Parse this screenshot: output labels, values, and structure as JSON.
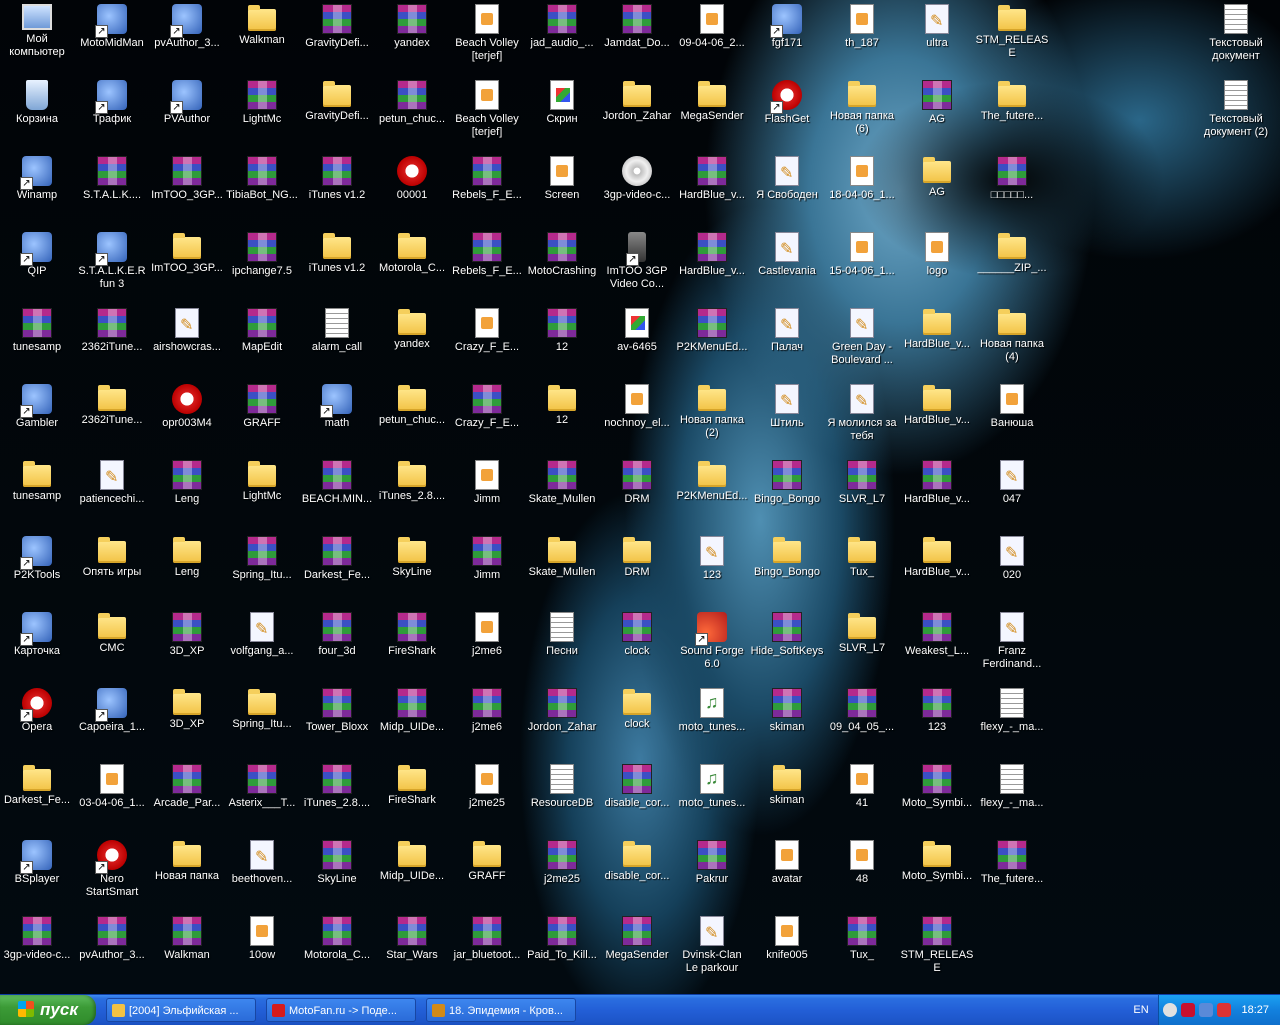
{
  "desktop": {
    "columns": [
      [
        {
          "label": "Мой компьютер",
          "icon": "my-computer-icon"
        },
        {
          "label": "Корзина",
          "icon": "recycle-bin-icon"
        },
        {
          "label": "Winamp",
          "icon": "winamp-icon"
        },
        {
          "label": "QIP",
          "icon": "qip-icon"
        },
        {
          "label": "tunesamp",
          "icon": "rar-archive-icon"
        },
        {
          "label": "Gambler",
          "icon": "gambler-icon"
        },
        {
          "label": "tunesamp",
          "icon": "folder-icon"
        },
        {
          "label": "P2KTools",
          "icon": "p2ktools-icon"
        },
        {
          "label": "Карточка",
          "icon": "shortcut-icon"
        },
        {
          "label": "Opera",
          "icon": "opera-icon"
        },
        {
          "label": "Darkest_Fe...",
          "icon": "folder-icon"
        },
        {
          "label": "BSplayer",
          "icon": "bsplayer-icon"
        },
        {
          "label": "3gp-video-c...",
          "icon": "rar-archive-icon"
        }
      ],
      [
        {
          "label": "MotoMidMan",
          "icon": "motomidman-icon"
        },
        {
          "label": "Трафик",
          "icon": "traffic-icon"
        },
        {
          "label": "S.T.A.L.K....",
          "icon": "rar-archive-icon"
        },
        {
          "label": "S.T.A.L.K.E.R fun 3",
          "icon": "3gp-icon"
        },
        {
          "label": "2362iTune...",
          "icon": "rar-archive-icon"
        },
        {
          "label": "2362iTune...",
          "icon": "folder-icon"
        },
        {
          "label": "patiencechi...",
          "icon": "jar-file-icon"
        },
        {
          "label": "Опять игры",
          "icon": "folder-icon"
        },
        {
          "label": "CMC",
          "icon": "folder-icon"
        },
        {
          "label": "Capoeira_1...",
          "icon": "3gp-icon"
        },
        {
          "label": "03-04-06_1...",
          "icon": "image-file-icon"
        },
        {
          "label": "Nero StartSmart",
          "icon": "nero-icon"
        },
        {
          "label": "pvAuthor_3...",
          "icon": "rar-archive-icon"
        }
      ],
      [
        {
          "label": "pvAuthor_3...",
          "icon": "installer-icon"
        },
        {
          "label": "PVAuthor",
          "icon": "pvauthor-icon"
        },
        {
          "label": "ImTOO_3GP...",
          "icon": "rar-archive-icon"
        },
        {
          "label": "ImTOO_3GP...",
          "icon": "folder-icon"
        },
        {
          "label": "airshowcras...",
          "icon": "jar-file-icon"
        },
        {
          "label": "opr003M4",
          "icon": "opera-file-icon"
        },
        {
          "label": "Leng",
          "icon": "rar-archive-icon"
        },
        {
          "label": "Leng",
          "icon": "folder-icon"
        },
        {
          "label": "3D_XP",
          "icon": "rar-archive-icon"
        },
        {
          "label": "3D_XP",
          "icon": "folder-icon"
        },
        {
          "label": "Arcade_Par...",
          "icon": "rar-archive-icon"
        },
        {
          "label": "Новая папка",
          "icon": "folder-icon"
        },
        {
          "label": "Walkman",
          "icon": "rar-archive-icon"
        }
      ],
      [
        {
          "label": "Walkman",
          "icon": "folder-icon"
        },
        {
          "label": "LightMc",
          "icon": "rar-archive-icon"
        },
        {
          "label": "TibiaBot_NG...",
          "icon": "rar-archive-icon"
        },
        {
          "label": "ipchange7.5",
          "icon": "rar-archive-icon"
        },
        {
          "label": "MapEdit",
          "icon": "rar-archive-icon"
        },
        {
          "label": "GRAFF",
          "icon": "rar-archive-icon"
        },
        {
          "label": "LightMc",
          "icon": "folder-icon"
        },
        {
          "label": "Spring_Itu...",
          "icon": "rar-archive-icon"
        },
        {
          "label": "volfgang_a...",
          "icon": "jar-file-icon"
        },
        {
          "label": "Spring_Itu...",
          "icon": "folder-icon"
        },
        {
          "label": "Asterix___T...",
          "icon": "rar-archive-icon"
        },
        {
          "label": "beethoven...",
          "icon": "jar-file-icon"
        },
        {
          "label": "10ow",
          "icon": "image-file-icon"
        }
      ],
      [
        {
          "label": "GravityDefi...",
          "icon": "rar-archive-icon"
        },
        {
          "label": "GravityDefi...",
          "icon": "folder-icon"
        },
        {
          "label": "iTunes v1.2",
          "icon": "rar-archive-icon"
        },
        {
          "label": "iTunes v1.2",
          "icon": "folder-icon"
        },
        {
          "label": "alarm_call",
          "icon": "text-file-icon"
        },
        {
          "label": "math",
          "icon": "math-icon"
        },
        {
          "label": "BEACH.MIN...",
          "icon": "rar-archive-icon"
        },
        {
          "label": "Darkest_Fe...",
          "icon": "rar-archive-icon"
        },
        {
          "label": "four_3d",
          "icon": "rar-archive-icon"
        },
        {
          "label": "Tower_Bloxx",
          "icon": "rar-archive-icon"
        },
        {
          "label": "iTunes_2.8....",
          "icon": "rar-archive-icon"
        },
        {
          "label": "SkyLine",
          "icon": "rar-archive-icon"
        },
        {
          "label": "Motorola_C...",
          "icon": "rar-archive-icon"
        }
      ],
      [
        {
          "label": "yandex",
          "icon": "rar-archive-icon"
        },
        {
          "label": "petun_chuc...",
          "icon": "rar-archive-icon"
        },
        {
          "label": "00001",
          "icon": "opera-file-icon"
        },
        {
          "label": "Motorola_C...",
          "icon": "folder-icon"
        },
        {
          "label": "yandex",
          "icon": "folder-icon"
        },
        {
          "label": "petun_chuc...",
          "icon": "folder-icon"
        },
        {
          "label": "iTunes_2.8....",
          "icon": "folder-icon"
        },
        {
          "label": "SkyLine",
          "icon": "folder-icon"
        },
        {
          "label": "FireShark",
          "icon": "rar-archive-icon"
        },
        {
          "label": "Midp_UIDe...",
          "icon": "rar-archive-icon"
        },
        {
          "label": "FireShark",
          "icon": "folder-icon"
        },
        {
          "label": "Midp_UIDe...",
          "icon": "folder-icon"
        },
        {
          "label": "Star_Wars",
          "icon": "rar-archive-icon"
        }
      ],
      [
        {
          "label": "Beach Volley [terjef]",
          "icon": "jad-file-icon"
        },
        {
          "label": "Beach Volley [terjef]",
          "icon": "jad-file-icon"
        },
        {
          "label": "Rebels_F_E...",
          "icon": "rar-archive-icon"
        },
        {
          "label": "Rebels_F_E...",
          "icon": "rar-archive-icon"
        },
        {
          "label": "Crazy_F_E...",
          "icon": "jad-file-icon"
        },
        {
          "label": "Crazy_F_E...",
          "icon": "rar-archive-icon"
        },
        {
          "label": "Jimm",
          "icon": "jad-file-icon"
        },
        {
          "label": "Jimm",
          "icon": "rar-archive-icon"
        },
        {
          "label": "j2me6",
          "icon": "jad-file-icon"
        },
        {
          "label": "j2me6",
          "icon": "rar-archive-icon"
        },
        {
          "label": "j2me25",
          "icon": "jad-file-icon"
        },
        {
          "label": "GRAFF",
          "icon": "folder-icon"
        },
        {
          "label": "jar_bluetoot...",
          "icon": "rar-archive-icon"
        }
      ],
      [
        {
          "label": "jad_audio_...",
          "icon": "rar-archive-icon"
        },
        {
          "label": "Скрин",
          "icon": "paint-icon"
        },
        {
          "label": "Screen",
          "icon": "image-file-icon"
        },
        {
          "label": "MotoCrashing",
          "icon": "rar-archive-icon"
        },
        {
          "label": "12",
          "icon": "rar-archive-icon"
        },
        {
          "label": "12",
          "icon": "folder-icon"
        },
        {
          "label": "Skate_Mullen",
          "icon": "rar-archive-icon"
        },
        {
          "label": "Skate_Mullen",
          "icon": "folder-icon"
        },
        {
          "label": "Песни",
          "icon": "text-file-icon"
        },
        {
          "label": "Jordon_Zahar",
          "icon": "rar-archive-icon"
        },
        {
          "label": "ResourceDB",
          "icon": "resource-file-icon"
        },
        {
          "label": "j2me25",
          "icon": "rar-archive-icon"
        },
        {
          "label": "Paid_To_Kill...",
          "icon": "rar-archive-icon"
        }
      ],
      [
        {
          "label": "Jamdat_Do...",
          "icon": "rar-archive-icon"
        },
        {
          "label": "Jordon_Zahar",
          "icon": "folder-icon"
        },
        {
          "label": "3gp-video-c...",
          "icon": "disc-icon"
        },
        {
          "label": "ImTOO 3GP Video Co...",
          "icon": "phone-icon"
        },
        {
          "label": "av-6465",
          "icon": "png-file-icon"
        },
        {
          "label": "nochnoy_el...",
          "icon": "image-file-icon"
        },
        {
          "label": "DRM",
          "icon": "rar-archive-icon"
        },
        {
          "label": "DRM",
          "icon": "folder-icon"
        },
        {
          "label": "clock",
          "icon": "rar-archive-icon"
        },
        {
          "label": "clock",
          "icon": "folder-icon"
        },
        {
          "label": "disable_cor...",
          "icon": "rar-archive-icon"
        },
        {
          "label": "disable_cor...",
          "icon": "folder-icon"
        },
        {
          "label": "MegaSender",
          "icon": "rar-archive-icon"
        }
      ],
      [
        {
          "label": "09-04-06_2...",
          "icon": "image-file-icon"
        },
        {
          "label": "MegaSender",
          "icon": "folder-icon"
        },
        {
          "label": "HardBlue_v...",
          "icon": "rar-archive-icon"
        },
        {
          "label": "HardBlue_v...",
          "icon": "rar-archive-icon"
        },
        {
          "label": "P2KMenuEd...",
          "icon": "rar-archive-icon"
        },
        {
          "label": "Новая папка (2)",
          "icon": "folder-icon"
        },
        {
          "label": "P2KMenuEd...",
          "icon": "folder-icon"
        },
        {
          "label": "123",
          "icon": "jar-file-icon"
        },
        {
          "label": "Sound Forge 6.0",
          "icon": "sound-forge-icon"
        },
        {
          "label": "moto_tunes...",
          "icon": "music-disc-icon"
        },
        {
          "label": "moto_tunes...",
          "icon": "music-disc-icon"
        },
        {
          "label": "Pakrur",
          "icon": "rar-archive-icon"
        },
        {
          "label": "Dvinsk-Clan Le parkour",
          "icon": "jar-file-icon"
        }
      ],
      [
        {
          "label": "fgf171",
          "icon": "installer-icon"
        },
        {
          "label": "FlashGet",
          "icon": "flashget-icon"
        },
        {
          "label": "Я Свободен",
          "icon": "jar-file-icon"
        },
        {
          "label": "Castlevania",
          "icon": "jar-file-icon"
        },
        {
          "label": "Палач",
          "icon": "jar-file-icon"
        },
        {
          "label": "Штиль",
          "icon": "jar-file-icon"
        },
        {
          "label": "Bingo_Bongo",
          "icon": "rar-archive-icon"
        },
        {
          "label": "Bingo_Bongo",
          "icon": "folder-icon"
        },
        {
          "label": "Hide_SoftKeys",
          "icon": "rar-archive-icon"
        },
        {
          "label": "skiman",
          "icon": "rar-archive-icon"
        },
        {
          "label": "skiman",
          "icon": "folder-icon"
        },
        {
          "label": "avatar",
          "icon": "image-file-icon"
        },
        {
          "label": "knife005",
          "icon": "image-file-icon"
        }
      ],
      [
        {
          "label": "th_187",
          "icon": "image-file-icon"
        },
        {
          "label": "Новая папка (6)",
          "icon": "folder-icon"
        },
        {
          "label": "18-04-06_1...",
          "icon": "image-file-icon"
        },
        {
          "label": "15-04-06_1...",
          "icon": "image-file-icon"
        },
        {
          "label": "Green Day - Boulevard ...",
          "icon": "jar-file-icon"
        },
        {
          "label": "Я молился за тебя",
          "icon": "jar-file-icon"
        },
        {
          "label": "SLVR_L7",
          "icon": "rar-archive-icon"
        },
        {
          "label": "Tux_",
          "icon": "folder-icon"
        },
        {
          "label": "SLVR_L7",
          "icon": "folder-icon"
        },
        {
          "label": "09_04_05_...",
          "icon": "rar-archive-icon"
        },
        {
          "label": "41",
          "icon": "image-file-icon"
        },
        {
          "label": "48",
          "icon": "image-file-icon"
        },
        {
          "label": "Tux_",
          "icon": "rar-archive-icon"
        }
      ],
      [
        {
          "label": "ultra",
          "icon": "jar-file-icon"
        },
        {
          "label": "AG",
          "icon": "rar-archive-icon"
        },
        {
          "label": "AG",
          "icon": "folder-icon"
        },
        {
          "label": "logo",
          "icon": "image-file-icon"
        },
        {
          "label": "HardBlue_v...",
          "icon": "folder-icon"
        },
        {
          "label": "HardBlue_v...",
          "icon": "folder-icon"
        },
        {
          "label": "HardBlue_v...",
          "icon": "rar-archive-icon"
        },
        {
          "label": "HardBlue_v...",
          "icon": "folder-icon"
        },
        {
          "label": "Weakest_L...",
          "icon": "rar-archive-icon"
        },
        {
          "label": "123",
          "icon": "rar-archive-icon"
        },
        {
          "label": "Moto_Symbi...",
          "icon": "rar-archive-icon"
        },
        {
          "label": "Moto_Symbi...",
          "icon": "folder-icon"
        },
        {
          "label": "STM_RELEASE",
          "icon": "rar-archive-icon"
        }
      ],
      [
        {
          "label": "STM_RELEASE",
          "icon": "folder-icon"
        },
        {
          "label": "The_futere...",
          "icon": "folder-icon"
        },
        {
          "label": "□□□□□...",
          "icon": "rar-archive-icon"
        },
        {
          "label": "______ZIP_...",
          "icon": "folder-icon"
        },
        {
          "label": "Новая папка (4)",
          "icon": "folder-icon"
        },
        {
          "label": "Ванюша",
          "icon": "image-file-icon"
        },
        {
          "label": "047",
          "icon": "jar-file-icon"
        },
        {
          "label": "020",
          "icon": "jar-file-icon"
        },
        {
          "label": "Franz Ferdinand...",
          "icon": "jar-file-icon"
        },
        {
          "label": "flexy_-_ma...",
          "icon": "resource-file-icon"
        },
        {
          "label": "flexy_-_ma...",
          "icon": "resource-file-icon"
        },
        {
          "label": "The_futere...",
          "icon": "rar-archive-icon"
        }
      ]
    ],
    "right_column": [
      {
        "label": "Текстовый документ",
        "icon": "text-file-icon"
      },
      {
        "label": "Текстовый документ (2)",
        "icon": "text-file-icon"
      }
    ]
  },
  "taskbar": {
    "start_label": "пуск",
    "tasks": [
      {
        "label": "[2004] Эльфийская ...",
        "icon": "folder-icon",
        "color": "#f2c244"
      },
      {
        "label": "MotoFan.ru -> Поде...",
        "icon": "opera-icon",
        "color": "#d61b1b"
      },
      {
        "label": "18. Эпидемия - Кров...",
        "icon": "jar-file-icon",
        "color": "#d28a18"
      }
    ],
    "language": "EN",
    "clock": "18:27"
  }
}
